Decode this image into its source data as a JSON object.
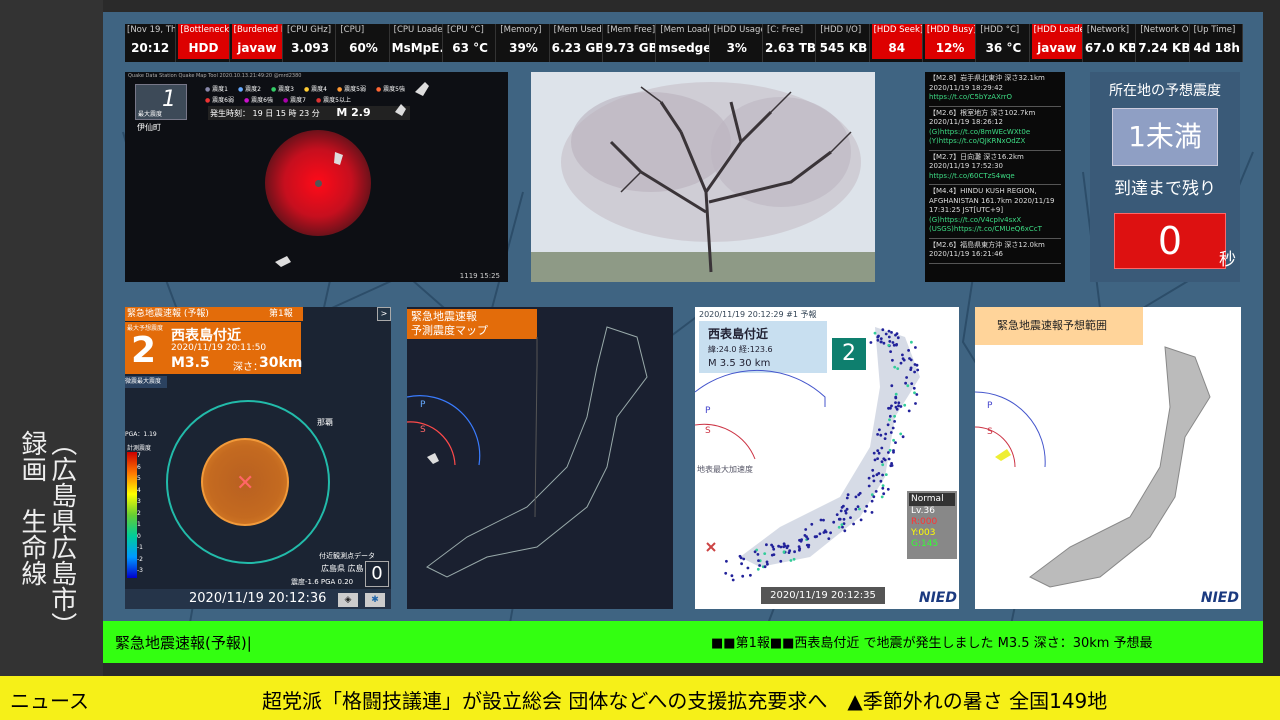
{
  "vertical_label": "（広島県広島市）\n録画　生命線",
  "monitor": [
    {
      "head": "[Nov 19, Thu]",
      "val": "20:12",
      "red": false
    },
    {
      "head": "[Bottleneck]",
      "val": "HDD",
      "red": true
    },
    {
      "head": "[Burdened By]",
      "val": "javaw",
      "red": true
    },
    {
      "head": "[CPU GHz]",
      "val": "3.093",
      "red": false
    },
    {
      "head": "[CPU]",
      "val": "60%",
      "red": false
    },
    {
      "head": "[CPU Loader]",
      "val": "MsMpE...",
      "red": false
    },
    {
      "head": "[CPU °C]",
      "val": "63 °C",
      "red": false
    },
    {
      "head": "[Memory]",
      "val": "39%",
      "red": false
    },
    {
      "head": "[Mem Used]",
      "val": "6.23 GB",
      "red": false
    },
    {
      "head": "[Mem Free]",
      "val": "9.73 GB",
      "red": false
    },
    {
      "head": "[Mem Loader]",
      "val": "msedge...",
      "red": false
    },
    {
      "head": "[HDD Usage]",
      "val": "3%",
      "red": false
    },
    {
      "head": "[C: Free]",
      "val": "2.63 TB",
      "red": false
    },
    {
      "head": "[HDD I/O]",
      "val": "545 KB",
      "red": false
    },
    {
      "head": "[HDD Seek]",
      "val": "84",
      "red": true
    },
    {
      "head": "[HDD Busy]",
      "val": "12%",
      "red": true
    },
    {
      "head": "[HDD °C]",
      "val": "36 °C",
      "red": false
    },
    {
      "head": "[HDD Loader]",
      "val": "javaw",
      "red": true
    },
    {
      "head": "[Network]",
      "val": "67.0 KB",
      "red": false
    },
    {
      "head": "[Network OUT]",
      "val": "7.24 KB",
      "red": false
    },
    {
      "head": "[Up Time]",
      "val": "4d 18h",
      "red": false
    }
  ],
  "quake_map": {
    "header_text": "Quake Data Station  Quake Map Tool 2020.10.13.21:49:20 @mrd2380",
    "max_label": "最大震度",
    "max_value": "1",
    "legend": [
      "震度1",
      "震度2",
      "震度3",
      "震度4",
      "震度5弱",
      "震度5強",
      "震度6弱",
      "震度6強",
      "震度7",
      "震度5以上"
    ],
    "time_label": "発生時刻：",
    "time_value": "19 日 15 時 23 分",
    "magnitude": "M 2.9",
    "place": "伊仙町",
    "footer": "1119 15:25"
  },
  "feed": [
    {
      "title": "【M2.8】岩手県北東沖 深さ32.1km",
      "time": "2020/11/19 18:29:42",
      "links": [
        "https://t.co/C5bYzAXrrO"
      ]
    },
    {
      "title": "【M2.6】根室地方 深さ102.7km",
      "time": "2020/11/19 18:26:12",
      "links": [
        "(G)https://t.co/8mWEcWXt0e",
        "(Y)https://t.co/QJKRNxOdZX"
      ]
    },
    {
      "title": "【M2.7】日向灘 深さ16.2km",
      "time": "2020/11/19 17:52:30",
      "links": [
        "https://t.co/60CTzS4wqe"
      ]
    },
    {
      "title": "【M4.4】HINDU KUSH REGION, AFGHANISTAN 161.7km 2020/11/19 17:31:25 JST[UTC+9]",
      "time": "",
      "links": [
        "(G)https://t.co/V4cpIv4sxX",
        "(USGS)https://t.co/CMUeQ6xCcT"
      ]
    },
    {
      "title": "【M2.6】福島県東方沖 深さ12.0km",
      "time": "2020/11/19 16:21:46",
      "links": []
    }
  ],
  "intensity": {
    "title": "所在地の予想震度",
    "value": "1未満",
    "remaining_label": "到達まで残り",
    "seconds": "0",
    "unit": "秒"
  },
  "eew": {
    "title": "緊急地震速報 (予報)",
    "report": "第1報",
    "max_label": "最大予想震度",
    "max_value": "2",
    "region": "西表島付近",
    "datetime": "2020/11/19 20:11:50",
    "magnitude": "M3.5",
    "depth_label": "深さ：",
    "depth": "30km",
    "tag": "微震最大震度",
    "pga_label": "PGA：1.19",
    "scale_title": "計測震度",
    "scale": [
      "7",
      "6",
      "5",
      "4",
      "3",
      "2",
      "1",
      "0",
      "-1",
      "-2",
      "-3"
    ],
    "city_label": "那覇",
    "nearby_title": "付近観測点データ",
    "station": "広島県 広島",
    "station_values": "震度-1.6  PGA 0.20",
    "station_intensity": "0",
    "timestamp": "2020/11/19 20:12:36"
  },
  "forecast": {
    "title_line1": "緊急地震速報",
    "title_line2": "予測震度マップ",
    "p_label": "P",
    "s_label": "S"
  },
  "accel": {
    "header": "2020/11/19 20:12:29  #1   予報",
    "region": "西表島付近",
    "coords": "緯:24.0   経:123.6",
    "mag_line": "M  3.5    30  km",
    "intensity": "2",
    "caption": "地表最大加速度",
    "status": "Normal",
    "level": "Lv.36",
    "r": "R:000",
    "y": "Y:003",
    "g": "G:145",
    "timestamp": "2020/11/19 20:12:35",
    "logo": "NIED",
    "p_label": "P",
    "s_label": "S"
  },
  "range_map": {
    "title": "緊急地震速報予想範囲",
    "logo": "NIED",
    "p_label": "P",
    "s_label": "S"
  },
  "eew_banner": {
    "left": "緊急地震速報(予報)|",
    "right": "■■第1報■■西表島付近 で地震が発生しました  M3.5  深さ：30km  予想最"
  },
  "news": {
    "label": "ニュース",
    "ticker": "超党派「格闘技議連」が設立総会 団体などへの支援拡充要求へ　▲季節外れの暑さ 全国149地"
  },
  "colors": {
    "eew_orange": "#e36c0a",
    "banner_green": "#33ff11",
    "news_yellow": "#f6f018",
    "intensity_box": "#8f9fc4",
    "seconds_red": "#dd1111"
  }
}
